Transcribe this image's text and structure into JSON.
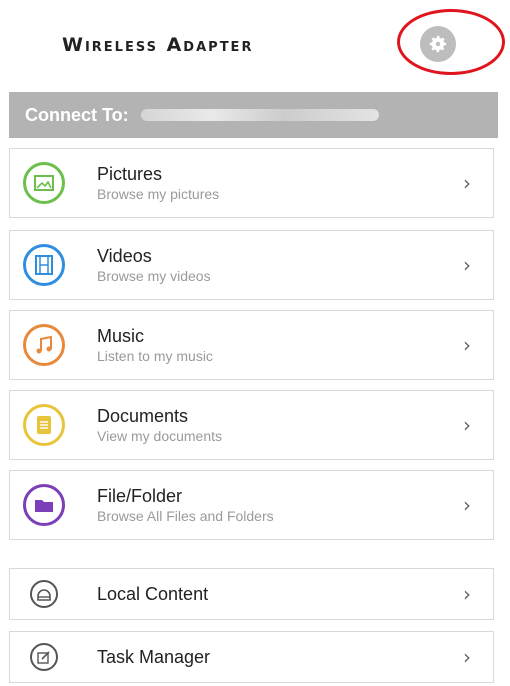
{
  "header": {
    "title": "Wireless Adapter",
    "settings_icon": "gear-icon",
    "highlight_color": "#e0141e"
  },
  "connect": {
    "label": "Connect To:"
  },
  "items": [
    {
      "title": "Pictures",
      "subtitle": "Browse my pictures",
      "icon": "picture-icon",
      "color": "#6cbf4a"
    },
    {
      "title": "Videos",
      "subtitle": "Browse my videos",
      "icon": "film-icon",
      "color": "#2f8ee0"
    },
    {
      "title": "Music",
      "subtitle": "Listen to my music",
      "icon": "music-note-icon",
      "color": "#e8893a"
    },
    {
      "title": "Documents",
      "subtitle": "View my documents",
      "icon": "document-icon",
      "color": "#e8c43a"
    },
    {
      "title": "File/Folder",
      "subtitle": "Browse All Files and Folders",
      "icon": "folder-icon",
      "color": "#7b3fb8"
    }
  ],
  "extra_items": [
    {
      "title": "Local Content",
      "icon": "local-content-icon"
    },
    {
      "title": "Task Manager",
      "icon": "edit-icon"
    }
  ],
  "chevron": "›"
}
